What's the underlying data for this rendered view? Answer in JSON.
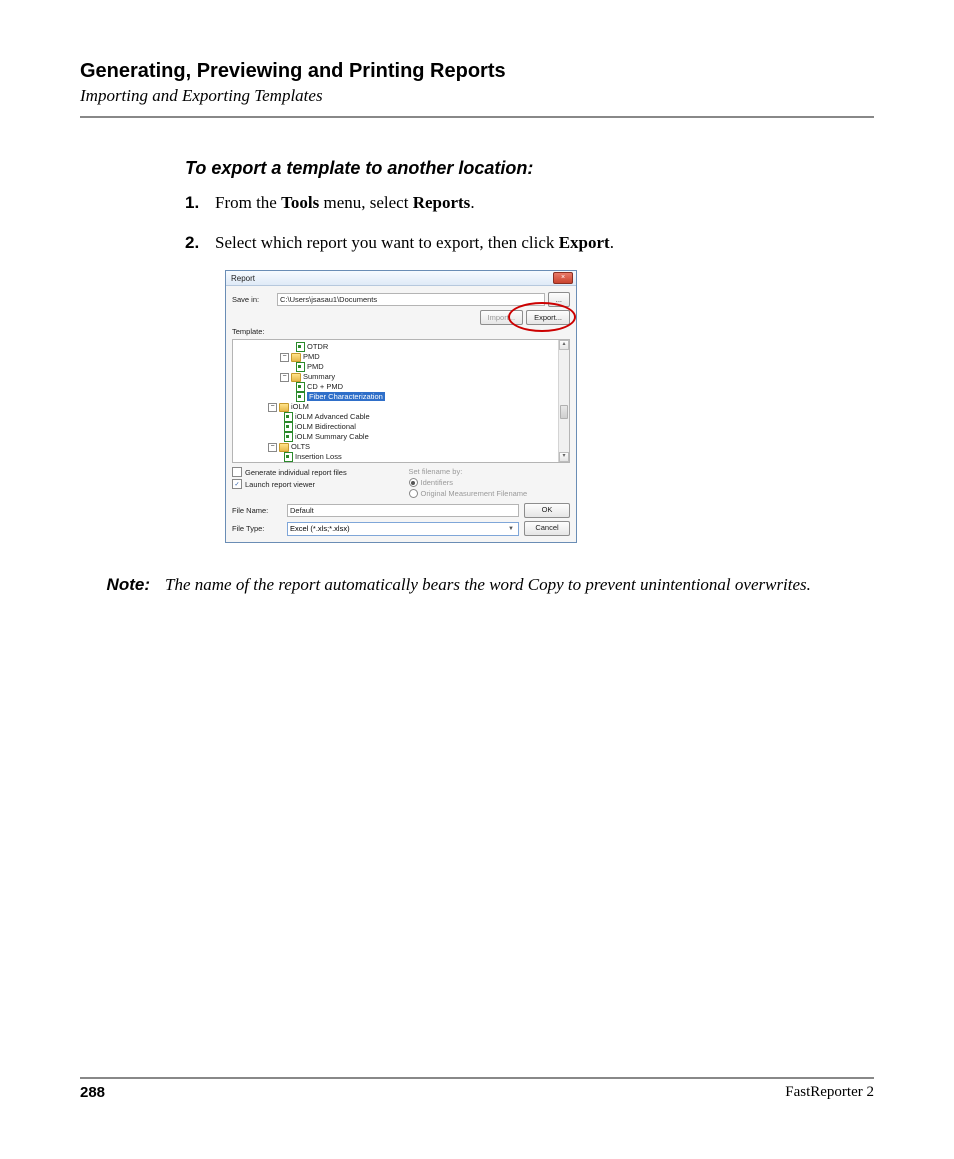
{
  "header": {
    "chapter": "Generating, Previewing and Printing Reports",
    "section": "Importing and Exporting Templates"
  },
  "procedure": {
    "heading": "To export a template to another location:",
    "steps": {
      "s1": {
        "num": "1.",
        "pre": "From the ",
        "b1": "Tools",
        "mid": " menu, select ",
        "b2": "Reports",
        "post": "."
      },
      "s2": {
        "num": "2.",
        "pre": "Select which report you want to export, then click ",
        "b1": "Export",
        "post": "."
      }
    }
  },
  "dialog": {
    "title": "Report",
    "close": "×",
    "savein_lbl": "Save in:",
    "savein_val": "C:\\Users\\jsasau1\\Documents",
    "path_btn": "...",
    "import_btn": "Import...",
    "export_btn": "Export...",
    "template_lbl": "Template:",
    "tree": {
      "otdr": "OTDR",
      "pmd_folder": "PMD",
      "pmd_file": "PMD",
      "summary": "Summary",
      "cdpmd": "CD + PMD",
      "fiberchar": "Fiber Characterization",
      "iolm": "iOLM",
      "iolm_adv": "iOLM Advanced Cable",
      "iolm_bidi": "iOLM Bidirectional",
      "iolm_sum": "iOLM Summary Cable",
      "olts": "OLTS",
      "ins_loss": "Insertion Loss"
    },
    "gen_individual": "Generate individual report files",
    "launch_viewer": "Launch report viewer",
    "set_filename": "Set filename by:",
    "identifiers": "Identifiers",
    "orig_meas": "Original Measurement Filename",
    "filename_lbl": "File Name:",
    "filename_val": "Default",
    "filetype_lbl": "File Type:",
    "filetype_val": "Excel (*.xls;*.xlsx)",
    "ok": "OK",
    "cancel": "Cancel"
  },
  "note": {
    "label": "Note:",
    "body": "The name of the report automatically bears the word Copy to prevent unintentional overwrites."
  },
  "footer": {
    "page": "288",
    "product": "FastReporter 2"
  }
}
